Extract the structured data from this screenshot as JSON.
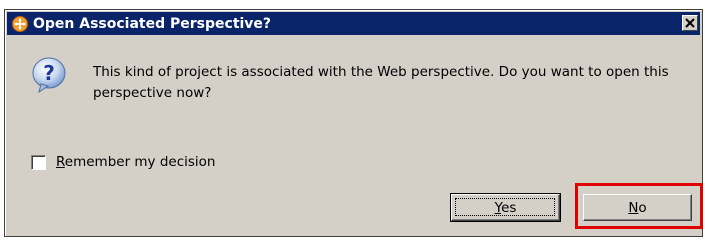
{
  "dialog": {
    "title": "Open Associated Perspective?",
    "message": "This kind of project is associated with the Web perspective.  Do you want to open this perspective now?",
    "checkbox_label_mnemonic": "R",
    "checkbox_label_rest": "emember my decision",
    "checkbox_checked": false,
    "yes_mnemonic": "Y",
    "yes_rest": "es",
    "no_mnemonic": "N",
    "no_rest": "o",
    "close_glyph": "✕"
  },
  "colors": {
    "titlebar": "#0a246a",
    "face": "#d4d0c8",
    "highlight": "#e00000"
  },
  "icons": {
    "title": "perspective-icon",
    "message": "question-icon"
  }
}
